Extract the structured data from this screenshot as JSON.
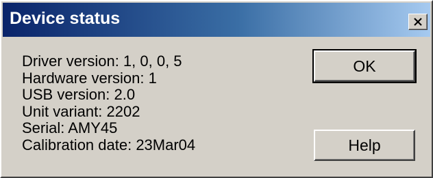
{
  "window": {
    "title": "Device status"
  },
  "icons": {
    "close": "close-icon"
  },
  "info": {
    "driver_version": "Driver version: 1, 0, 0, 5",
    "hardware_version": "Hardware version: 1",
    "usb_version": "USB version: 2.0",
    "unit_variant": "Unit variant: 2202",
    "serial": "Serial: AMY45",
    "calibration_date": "Calibration date: 23Mar04"
  },
  "buttons": {
    "ok_label": "OK",
    "help_label": "Help"
  },
  "colors": {
    "titlebar_start": "#0a246a",
    "titlebar_end": "#a6caf0",
    "face": "#d4d0c8"
  }
}
